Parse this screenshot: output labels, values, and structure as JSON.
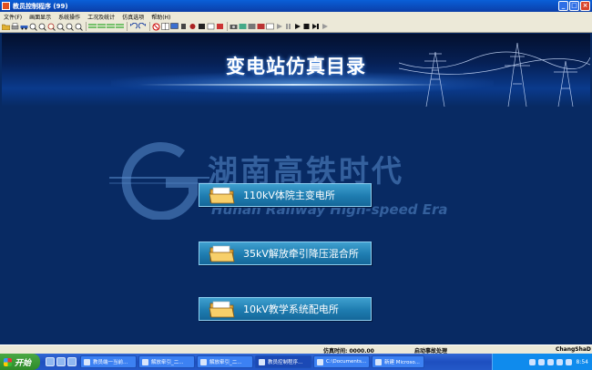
{
  "window": {
    "title": "教员控制程序 (99)"
  },
  "menu": [
    {
      "label": "文件(F)"
    },
    {
      "label": "画面显示"
    },
    {
      "label": "系统操作"
    },
    {
      "label": "工况及统计"
    },
    {
      "label": "仿真选项"
    },
    {
      "label": "帮助(H)"
    }
  ],
  "banner": {
    "title": "变电站仿真目录"
  },
  "watermark": {
    "cn": "湖南高铁时代",
    "en": "Hunan Railway High-speed Era",
    "logo_letter": "G"
  },
  "nav_buttons": [
    {
      "label": "110kV体院主变电所"
    },
    {
      "label": "35kV解放牵引降压混合所"
    },
    {
      "label": "10kV教学系统配电所"
    }
  ],
  "status": {
    "sim_time_label": "仿真时间: 0000.00",
    "accident_label": "启动事故处理",
    "location": "ChangShaD"
  },
  "taskbar": {
    "start": "开始",
    "tasks": [
      {
        "label": "教员端一当前..."
      },
      {
        "label": "解放牵引_二..."
      },
      {
        "label": "解放牵引_二..."
      },
      {
        "label": "教员控制程序..."
      },
      {
        "label": "C:\\Documents..."
      },
      {
        "label": "新建 Microso..."
      }
    ],
    "clock": "8:54"
  },
  "colors": {
    "background": "#082a63",
    "button": "#1e7cb0",
    "titlebar": "#0b3ea8",
    "menu_bg": "#ece9d8"
  }
}
